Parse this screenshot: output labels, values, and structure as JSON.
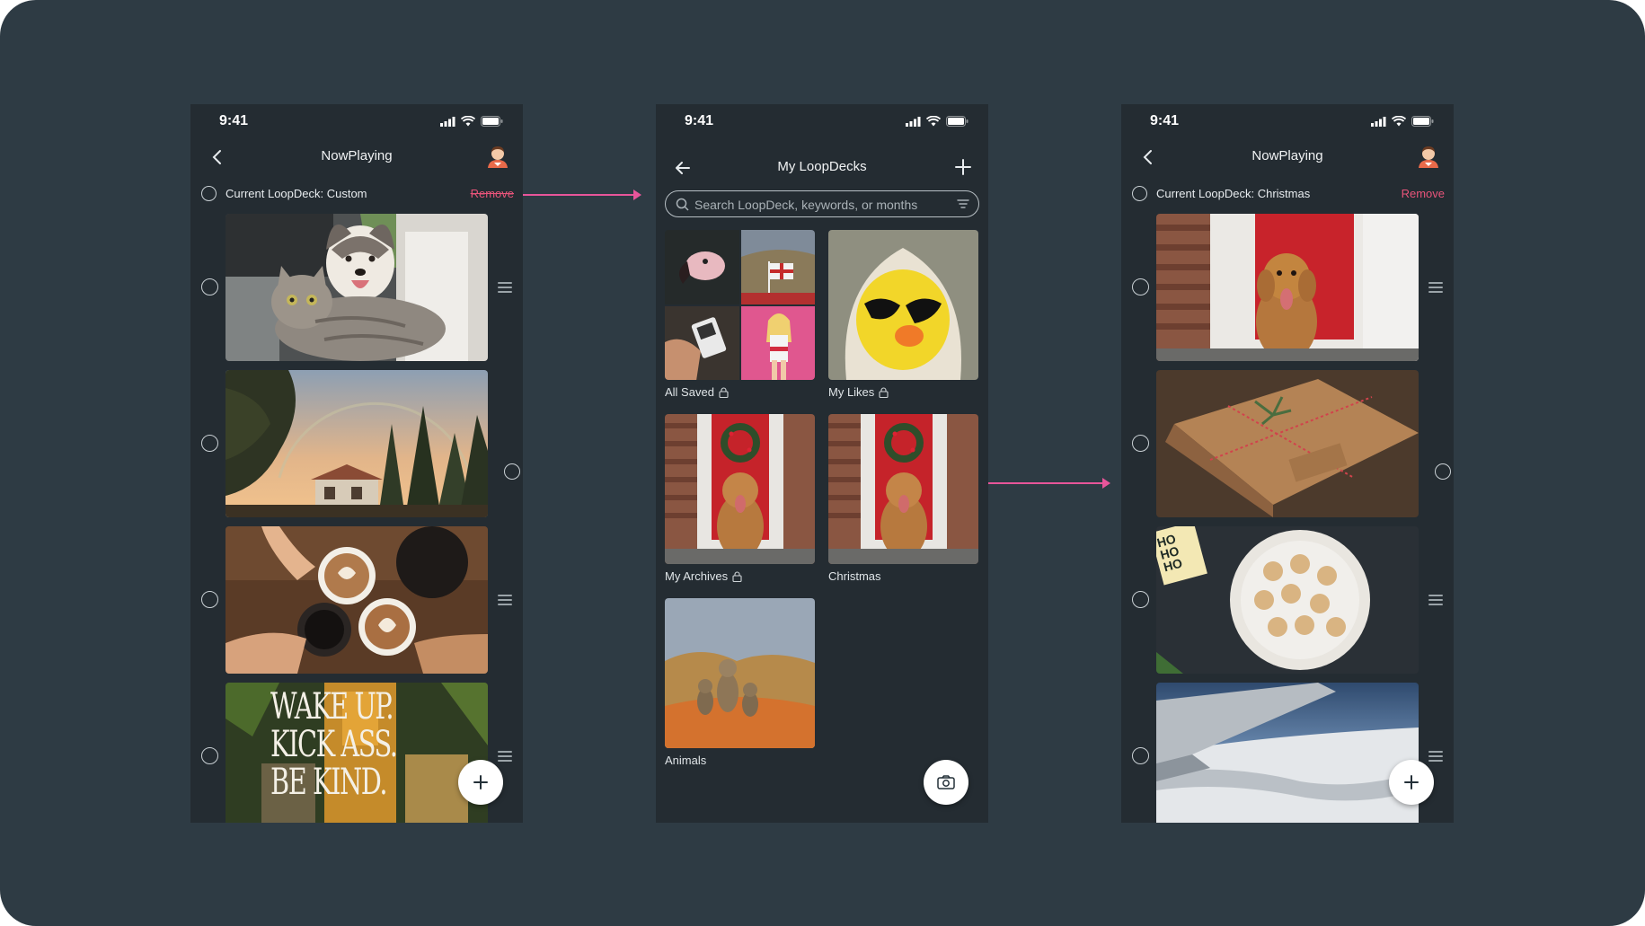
{
  "screens": {
    "left": {
      "time": "9:41",
      "title": "NowPlaying",
      "current_deck_label": "Current LoopDeck: Custom",
      "remove_label": "Remove",
      "photos": [
        "husky-and-cat",
        "sunset-rainbow-trees",
        "latte-cheers",
        "wake-up-poster"
      ],
      "poster_text": [
        "WAKE UP.",
        "KICK ASS.",
        "BE KIND."
      ]
    },
    "middle": {
      "time": "9:41",
      "title": "My LoopDecks",
      "search_placeholder": "Search LoopDeck, keywords, or months",
      "decks": [
        {
          "name": "All Saved",
          "locked": true
        },
        {
          "name": "My Likes",
          "locked": true
        },
        {
          "name": "My Archives",
          "locked": true
        },
        {
          "name": "Christmas",
          "locked": false
        },
        {
          "name": "Animals",
          "locked": false
        }
      ]
    },
    "right": {
      "time": "9:41",
      "title": "NowPlaying",
      "current_deck_label": "Current LoopDeck: Christmas",
      "remove_label": "Remove",
      "photos": [
        "dog-red-door",
        "wrapped-gift",
        "gingerbread-cookies",
        "airplane-wing-snow"
      ],
      "cookie_sign": "HO HO HO"
    }
  },
  "colors": {
    "canvas": "#2e3b44",
    "phone": "#242c32",
    "accent": "#e8559a",
    "remove": "#e8547a"
  }
}
